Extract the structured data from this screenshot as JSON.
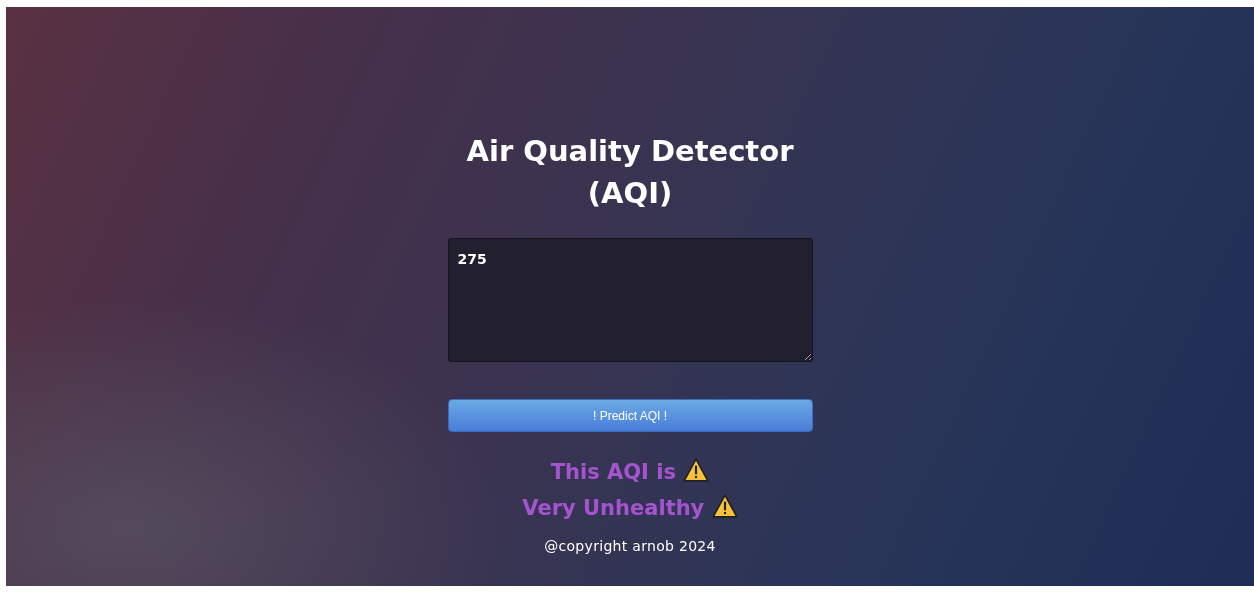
{
  "title": "Air Quality Detector (AQI)",
  "input": {
    "value": "275"
  },
  "button": {
    "label": "! Predict AQI !"
  },
  "result": {
    "prefix": "This AQI is",
    "category": "Very Unhealthy",
    "warning": true
  },
  "footer": "@copyright arnob 2024"
}
